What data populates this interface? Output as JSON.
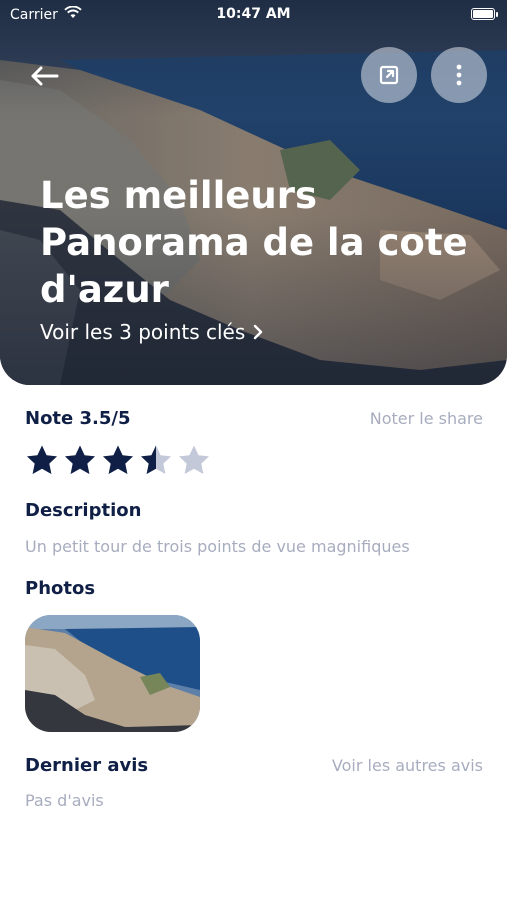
{
  "status": {
    "carrier": "Carrier",
    "time": "10:47 AM"
  },
  "hero": {
    "title": "Les meilleurs Panorama de la cote d'azur",
    "link_label": "Voir les 3 points clés"
  },
  "rating": {
    "label": "Note 3.5/5",
    "value": 3.5,
    "max": 5,
    "action_label": "Noter le share",
    "star_color": "#0f1f45",
    "star_empty_color": "#c3c9d8"
  },
  "description": {
    "heading": "Description",
    "text": "Un petit tour de trois points de vue magnifiques"
  },
  "photos": {
    "heading": "Photos"
  },
  "reviews": {
    "heading": "Dernier avis",
    "action_label": "Voir les autres avis",
    "empty_text": "Pas d'avis"
  },
  "icons": {
    "back": "arrow-left-icon",
    "share": "external-link-icon",
    "more": "more-vertical-icon",
    "link_chevron": "chevron-right-icon"
  }
}
